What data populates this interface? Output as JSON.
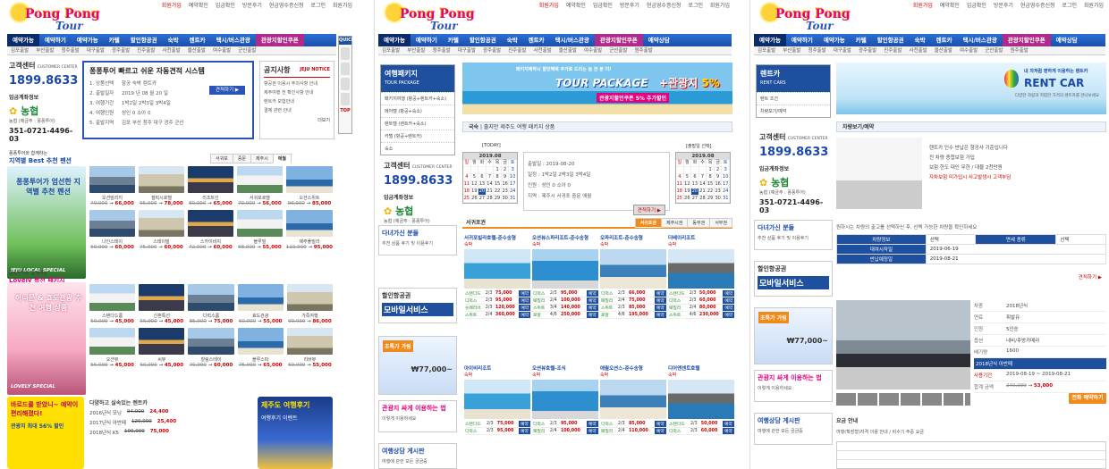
{
  "brand": {
    "line1": "Pong Pong",
    "line2": "Tour"
  },
  "topbar": [
    "회원가입",
    "예약확인",
    "입금확인",
    "방문후기",
    "현금영수증신청",
    "로그인",
    "회원가입"
  ],
  "nav": {
    "p1": [
      "예약가능",
      "예약하기",
      "예약가능",
      "카텔",
      "할인항공권",
      "숙박",
      "렌트카",
      "택시/버스관광",
      "관광지할인쿠폰"
    ],
    "p2": [
      "예약가능",
      "예약하기",
      "카텔",
      "할인항공권",
      "숙박",
      "렌트카",
      "택시/버스관광",
      "관광지할인쿠폰",
      "예약상담"
    ],
    "p3": [
      "예약가능",
      "예약하기",
      "예약가능",
      "카텔",
      "할인항공권",
      "숙박",
      "렌트카",
      "택시/버스관광",
      "관광지할인쿠폰",
      "예약상담"
    ]
  },
  "subnav": [
    "김포출발",
    "부산출발",
    "청주출발",
    "대구출발",
    "광주출발",
    "진주출발",
    "사천출발",
    "울산출발",
    "여수출발",
    "군산출발",
    "원주출발"
  ],
  "quick": {
    "title": "QUICK",
    "items": [
      "예약조회",
      "방문후기",
      "상담"
    ],
    "top": "TOP"
  },
  "cs": {
    "label": "고객센터",
    "label_en": "CUSTOMER CENTER",
    "phone": "1899.8633",
    "bank_label": "입금계좌정보",
    "bank_name": "농협",
    "holder": "농협 (예금주 : 퐁퐁투어)",
    "account": "351-0721-4496-03"
  },
  "quote": {
    "title": "퐁퐁투어 빠르고 쉬운 자동견적 시스템",
    "button": "견적하기 ▶",
    "rows": [
      {
        "label": "1. 상품선택",
        "value": "항공  숙박  렌트카"
      },
      {
        "label": "2. 출발일자",
        "value": "2019 년 08 월 20 일"
      },
      {
        "label": "3. 여행기간",
        "value": "1박2일  2박3일  3박4일"
      },
      {
        "label": "4. 여행인원",
        "value": "성인  0  소아  0"
      },
      {
        "label": "5. 출발지역",
        "value": "김포  부산  청주  대구  광주  군산"
      }
    ]
  },
  "notice": {
    "title": "공지사항",
    "badge": "JEJU NOTICE",
    "items": [
      "항공권 이용시 주의사항 안내",
      "제주여행 전 확인사항 안내",
      "렌트카 보험안내",
      "결제 관련 안내"
    ],
    "more": "더보기"
  },
  "section1": {
    "intro": "퐁퐁투어와 함께하는",
    "title": "지역별 Best 추천 펜션",
    "tabs": [
      "서귀포",
      "중문",
      "제주시",
      "애월"
    ],
    "promo": {
      "title": "퐁퐁투어가 엄선한 지역별 추천 펜션",
      "bottom": "JEJU LOCAL SPECIAL"
    },
    "cards": [
      {
        "name": "오션빌리지",
        "old": "79,000",
        "price": "66,000"
      },
      {
        "name": "갤럭시호텔",
        "old": "95,000",
        "price": "78,000"
      },
      {
        "name": "리조트인",
        "old": "80,000",
        "price": "65,000"
      },
      {
        "name": "서귀포호텔",
        "old": "70,000",
        "price": "56,000"
      },
      {
        "name": "오션스위트",
        "old": "99,000",
        "price": "85,000"
      },
      {
        "name": "나인스테이",
        "old": "69,000",
        "price": "60,000"
      },
      {
        "name": "스테이빌",
        "old": "75,000",
        "price": "60,000"
      },
      {
        "name": "스카이비치",
        "old": "72,000",
        "price": "60,000"
      },
      {
        "name": "블루빌",
        "old": "68,000",
        "price": "55,000"
      },
      {
        "name": "제주풀빌라",
        "old": "110,000",
        "price": "95,000"
      }
    ]
  },
  "section2": {
    "intro": "퐁퐁투어와 함께하는",
    "title": "Lovely 특선 패키지",
    "promo": {
      "title": "허니문 & 효도관광 추천 여행 상품",
      "bottom": "LOVELY SPECIAL"
    },
    "cards": [
      {
        "name": "스탠다드룸",
        "old": "59,000",
        "price": "45,000"
      },
      {
        "name": "신혼특선",
        "old": "55,000",
        "price": "45,000"
      },
      {
        "name": "디럭스룸",
        "old": "85,000",
        "price": "75,000"
      },
      {
        "name": "효도관광",
        "old": "60,000",
        "price": "55,000"
      },
      {
        "name": "가족여행",
        "old": "99,000",
        "price": "86,000"
      },
      {
        "name": "오션뷰",
        "old": "55,000",
        "price": "45,000"
      },
      {
        "name": "씨뷰",
        "old": "60,000",
        "price": "45,000"
      },
      {
        "name": "힐링스테이",
        "old": "70,000",
        "price": "60,000"
      },
      {
        "name": "블루스파",
        "old": "75,000",
        "price": "65,000"
      },
      {
        "name": "리버뷰",
        "old": "69,000",
        "price": "55,000"
      }
    ]
  },
  "bottom1": {
    "ad1": {
      "title": "바로드를 받았니~ 예약이 편리해졌다!",
      "sub": "관광지 최대 56% 할인"
    },
    "deals_title": "다양하고 실속있는 렌트카",
    "deals": [
      {
        "car": "2016년식 모닝",
        "old": "94,000",
        "price": "24,400"
      },
      {
        "car": "2017년식 아반떼",
        "old": "120,000",
        "price": "25,400"
      },
      {
        "car": "2018년식 K5",
        "old": "100,000",
        "price": "75,000"
      }
    ],
    "ad2": {
      "title": "제주도 여행후기",
      "sub": "여행후기 이벤트"
    }
  },
  "p2": {
    "side_title": "여행패키지",
    "side_sub": "TOUR PACKAGE",
    "side_items": [
      "패키지여행 (항공+렌트카+숙소)",
      "에어텔 (항공+숙소)",
      "렌트텔 (렌트카+숙소)",
      "카텔 (항공+렌트카)",
      "숙소"
    ],
    "banner_top": "패키지예약시 할인혜택 추가로 드리는 늘 한 분 더!",
    "banner_title": "TOUR PACKAGE",
    "banner_plus": "+관광지",
    "banner_pct": "5%",
    "banner_sub": "관광지할인쿠폰 5% 추가할인",
    "search_label": "국숙",
    "search_text": "출지만 제주도 여행 패키지 상품",
    "today_label": "[TODAY]",
    "cal_month": "2019.08",
    "cal_month2": "2019.08",
    "pick_label": "[출발일 선택]",
    "resv_date": "2019-08-20",
    "resv_rows": [
      "출발일 : 2019-08-20",
      "일정 : 1박2일  2박3일  3박4일",
      "인원 : 성인 0  소아 0",
      "지역 : 제주시  서귀포  중문  애월"
    ],
    "resv_btn": "견적하기 ▶",
    "tabs": [
      "서귀포권",
      "제주시권",
      "동부권",
      "서부권"
    ],
    "region": "서귀포권",
    "packages": [
      {
        "name": "서귀포빌라호텔-준수송형",
        "stay": "숙박",
        "rows": [
          [
            "스탠다드",
            "2/3",
            "75,000"
          ],
          [
            "디럭스",
            "2/3",
            "95,000"
          ],
          [
            "슈페리어",
            "2/3",
            "120,000"
          ],
          [
            "스위트",
            "2/4",
            "360,000"
          ]
        ]
      },
      {
        "name": "오션뷰스파리조트-준수송형",
        "stay": "숙박",
        "rows": [
          [
            "디럭스",
            "2/3",
            "95,000"
          ],
          [
            "패밀리",
            "2/4",
            "100,000"
          ],
          [
            "스위트",
            "3/4",
            "140,000"
          ],
          [
            "로얄",
            "4/6",
            "250,000"
          ]
        ]
      },
      {
        "name": "오파리조트-준수송형",
        "stay": "숙박",
        "rows": [
          [
            "디럭스",
            "2/3",
            "66,000"
          ],
          [
            "패밀리",
            "2/4",
            "75,000"
          ],
          [
            "스위트",
            "2/3",
            "85,000"
          ],
          [
            "로얄",
            "4/6",
            "195,000"
          ]
        ]
      },
      {
        "name": "더베이리조트",
        "stay": "숙박",
        "rows": [
          [
            "스탠다드",
            "2/3",
            "50,000"
          ],
          [
            "디럭스",
            "2/3",
            "60,000"
          ],
          [
            "패밀리",
            "2/4",
            "80,000"
          ],
          [
            "스위트",
            "4/6",
            "230,000"
          ]
        ]
      }
    ],
    "packages2": [
      {
        "name": "아이비리조트",
        "stay": "숙박",
        "rows": [
          [
            "스탠다드",
            "2/3",
            "75,000"
          ],
          [
            "디럭스",
            "2/3",
            "95,000"
          ]
        ]
      },
      {
        "name": "오션뷰호텔-조식",
        "stay": "숙박",
        "rows": [
          [
            "디럭스",
            "2/3",
            "95,000"
          ],
          [
            "패밀리",
            "2/4",
            "100,000"
          ]
        ]
      },
      {
        "name": "애월오션스-준수송형",
        "stay": "숙박",
        "rows": [
          [
            "디럭스",
            "2/3",
            "85,000"
          ],
          [
            "패밀리",
            "2/4",
            "110,000"
          ]
        ]
      },
      {
        "name": "디어앤센트호텔",
        "stay": "숙박",
        "rows": [
          [
            "스탠다드",
            "2/3",
            "50,000"
          ],
          [
            "디럭스",
            "2/3",
            "60,000"
          ]
        ]
      }
    ],
    "ads": [
      {
        "title": "다녀가신 분들",
        "sub": "추천 상품 후기 및 이용후기"
      },
      {
        "title": "할인항공권",
        "sub": "모바일서비스"
      },
      {
        "title": "초특가 가림",
        "sub": "₩77,000~"
      },
      {
        "title": "관광지 싸게 이용하는 법",
        "sub": "이렇게 이용하세요"
      },
      {
        "title": "여행상담 게시판",
        "sub": "여행에 관한 모든 궁금증"
      }
    ]
  },
  "p3": {
    "side_title": "렌트카",
    "side_sub": "RENT CARS",
    "side_items": [
      "렌트 조건",
      "차량보기/예약"
    ],
    "banner_text": "RENT CAR",
    "banner_top": "내 차처럼 편하게 이용하는 렌트카",
    "banner_sub": "다양한 차량과 저렴한 가격의 렌트카를 만나보세요",
    "search_label": "차량보기/예약",
    "info": [
      "렌트카 인수 반납은 항공사 기준입니다",
      "전 차량 종합보험 가입",
      "보험 한도 대인 무한 / 대물 2천만원",
      "자차보험 미가입시 사고발생시 고객부담"
    ],
    "notice": "원하시는 차량의 출고를 선택하신 후, 선택 가능한 차량을 확인하세요",
    "table": {
      "h1": "차량정보",
      "h2": "대여시작일",
      "h3": "반납예정일",
      "car_opt": "선택",
      "insurance": "면세 종류",
      "date1": "2019-06-19",
      "date2": "2019-08-21",
      "btn": "견적하기 ▶"
    },
    "car": {
      "name": "2018년식 아반떼",
      "fields": [
        [
          "차종",
          "2018년식"
        ],
        [
          "연료",
          "휘발유"
        ],
        [
          "인원",
          "5인승"
        ],
        [
          "옵션",
          "네비/후방카메라"
        ],
        [
          "배기량",
          "1600"
        ]
      ],
      "period_label": "사용기간",
      "period": "2019-08-19 ~ 2019-08-21",
      "total_label": "합계 금액",
      "old": "240,000",
      "price": "53,000",
      "btn": "전화 예약하기"
    },
    "lower_title": "요금 안내",
    "lower_note": "여행(확장형)자격 이용 안내 / 비수기 주중 요금"
  }
}
